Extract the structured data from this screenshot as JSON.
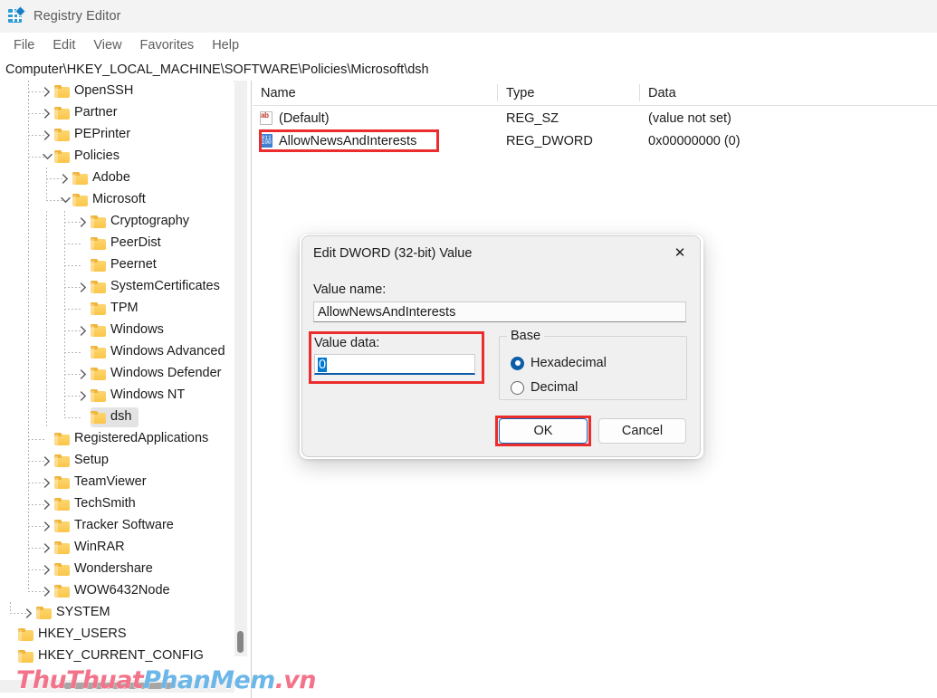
{
  "window": {
    "title": "Registry Editor",
    "icon": "registry-editor-icon"
  },
  "menu": {
    "items": [
      "File",
      "Edit",
      "View",
      "Favorites",
      "Help"
    ]
  },
  "address": {
    "path": "Computer\\HKEY_LOCAL_MACHINE\\SOFTWARE\\Policies\\Microsoft\\dsh"
  },
  "tree": {
    "nodes": [
      {
        "label": "OpenSSH",
        "depth": 1,
        "chevron": "right",
        "selected": false
      },
      {
        "label": "Partner",
        "depth": 1,
        "chevron": "right",
        "selected": false
      },
      {
        "label": "PEPrinter",
        "depth": 1,
        "chevron": "right",
        "selected": false
      },
      {
        "label": "Policies",
        "depth": 1,
        "chevron": "down",
        "selected": false
      },
      {
        "label": "Adobe",
        "depth": 2,
        "chevron": "right",
        "selected": false
      },
      {
        "label": "Microsoft",
        "depth": 2,
        "chevron": "down",
        "selected": false
      },
      {
        "label": "Cryptography",
        "depth": 3,
        "chevron": "right",
        "selected": false
      },
      {
        "label": "PeerDist",
        "depth": 3,
        "chevron": "none",
        "selected": false
      },
      {
        "label": "Peernet",
        "depth": 3,
        "chevron": "none",
        "selected": false
      },
      {
        "label": "SystemCertificates",
        "depth": 3,
        "chevron": "right",
        "selected": false
      },
      {
        "label": "TPM",
        "depth": 3,
        "chevron": "none",
        "selected": false
      },
      {
        "label": "Windows",
        "depth": 3,
        "chevron": "right",
        "selected": false
      },
      {
        "label": "Windows Advanced",
        "depth": 3,
        "chevron": "none",
        "selected": false
      },
      {
        "label": "Windows Defender",
        "depth": 3,
        "chevron": "right",
        "selected": false
      },
      {
        "label": "Windows NT",
        "depth": 3,
        "chevron": "right",
        "selected": false
      },
      {
        "label": "dsh",
        "depth": 3,
        "chevron": "none",
        "selected": true
      },
      {
        "label": "RegisteredApplications",
        "depth": 1,
        "chevron": "none",
        "selected": false
      },
      {
        "label": "Setup",
        "depth": 1,
        "chevron": "right",
        "selected": false
      },
      {
        "label": "TeamViewer",
        "depth": 1,
        "chevron": "right",
        "selected": false
      },
      {
        "label": "TechSmith",
        "depth": 1,
        "chevron": "right",
        "selected": false
      },
      {
        "label": "Tracker Software",
        "depth": 1,
        "chevron": "right",
        "selected": false
      },
      {
        "label": "WinRAR",
        "depth": 1,
        "chevron": "right",
        "selected": false
      },
      {
        "label": "Wondershare",
        "depth": 1,
        "chevron": "right",
        "selected": false
      },
      {
        "label": "WOW6432Node",
        "depth": 1,
        "chevron": "right",
        "selected": false
      },
      {
        "label": "SYSTEM",
        "depth": 0,
        "chevron": "right",
        "selected": false
      },
      {
        "label": "HKEY_USERS",
        "depth": -1,
        "chevron": "none",
        "selected": false
      },
      {
        "label": "HKEY_CURRENT_CONFIG",
        "depth": -1,
        "chevron": "none",
        "selected": false
      }
    ]
  },
  "list": {
    "columns": [
      "Name",
      "Type",
      "Data"
    ],
    "rows": [
      {
        "icon": "string-value-icon",
        "name": "(Default)",
        "type": "REG_SZ",
        "data": "(value not set)"
      },
      {
        "icon": "dword-value-icon",
        "name": "AllowNewsAndInterests",
        "type": "REG_DWORD",
        "data": "0x00000000 (0)"
      }
    ]
  },
  "dialog": {
    "title": "Edit DWORD (32-bit) Value",
    "close_label": "✕",
    "value_name_label": "Value name:",
    "value_name": "AllowNewsAndInterests",
    "value_data_label": "Value data:",
    "value_data": "0",
    "base_legend": "Base",
    "base_options": [
      {
        "label": "Hexadecimal",
        "checked": true
      },
      {
        "label": "Decimal",
        "checked": false
      }
    ],
    "ok_label": "OK",
    "cancel_label": "Cancel"
  },
  "watermark": {
    "part1": "ThuThuat",
    "part2": "PhanMem",
    "part3": ".vn"
  },
  "colors": {
    "annotation": "#ec2d2d",
    "accent": "#0d5ca8",
    "selection": "#0078d4",
    "folder": "#fbc64a"
  }
}
